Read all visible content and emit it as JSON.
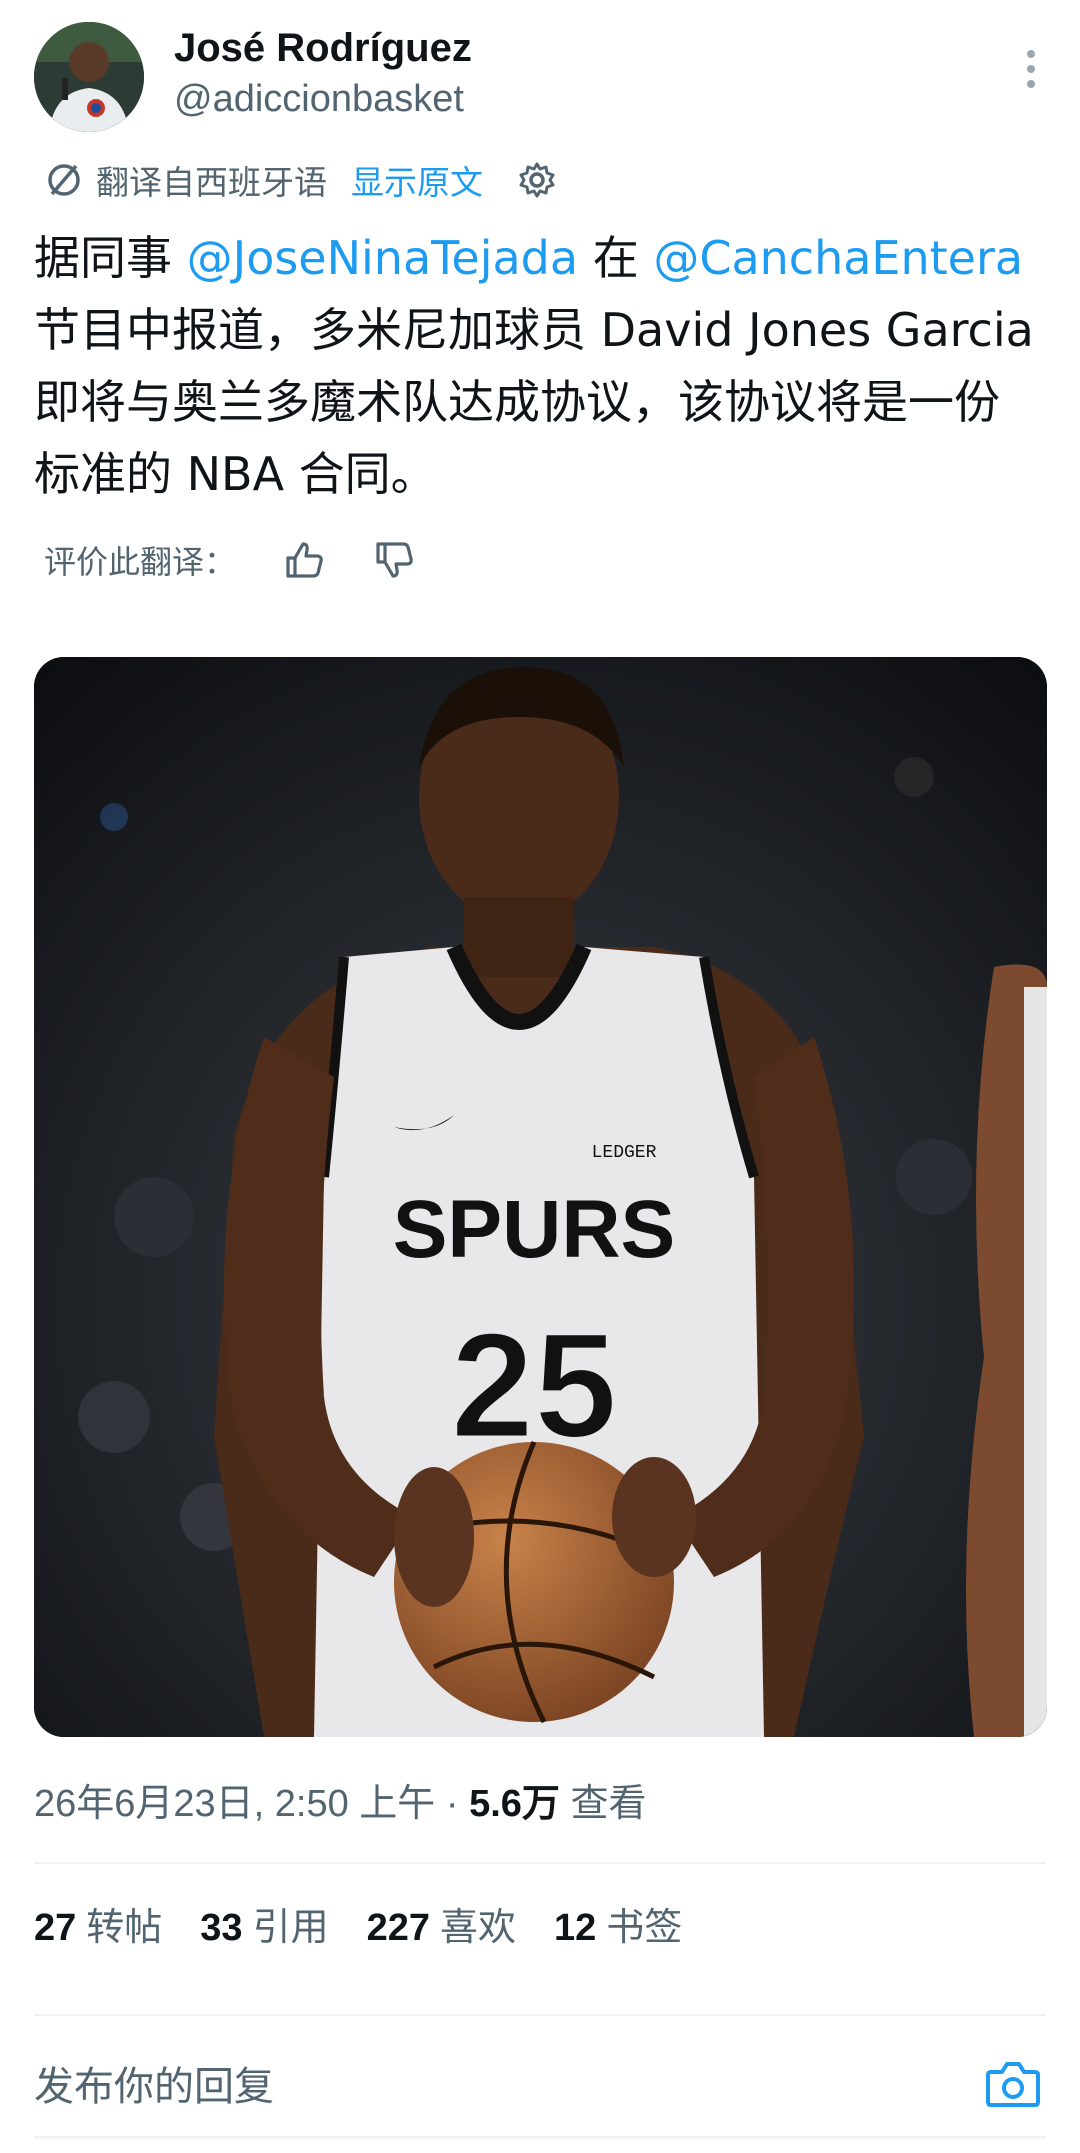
{
  "author": {
    "name": "José Rodríguez",
    "handle": "@adiccionbasket"
  },
  "translation_bar": {
    "translated_from": "翻译自西班牙语",
    "show_original": "显示原文"
  },
  "tweet": {
    "part1": "据同事 ",
    "mention1": "@JoseNinaTejada",
    "part2": " 在 ",
    "mention2": "@CanchaEntera",
    "part3": " 节目中报道，多米尼加球员 David Jones Garcia 即将与奥兰多魔术队达成协议，该协议将是一份标准的 NBA 合同。"
  },
  "rate": {
    "label": "评价此翻译："
  },
  "media": {
    "jersey_team": "SPURS",
    "jersey_number": "25",
    "sponsor": "LEDGER"
  },
  "meta": {
    "timestamp": "26年6月23日, 2:50 上午 · ",
    "views_count": "5.6万",
    "views_label": " 查看"
  },
  "stats": [
    {
      "num": "27",
      "label": "转帖"
    },
    {
      "num": "33",
      "label": "引用"
    },
    {
      "num": "227",
      "label": "喜欢"
    },
    {
      "num": "12",
      "label": "书签"
    }
  ],
  "reply": {
    "placeholder": "发布你的回复"
  },
  "colors": {
    "accent": "#1d9bf0",
    "secondary_text": "#536471",
    "primary_text": "#0f1419"
  }
}
